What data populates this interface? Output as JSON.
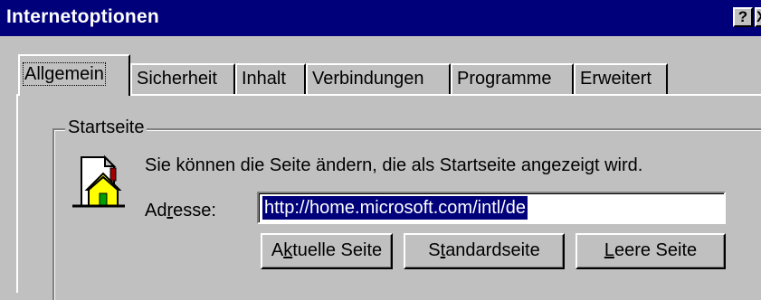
{
  "window": {
    "title": "Internetoptionen",
    "help_label": "?",
    "close_label": "X"
  },
  "tabs": [
    {
      "label": "Allgemein",
      "active": true
    },
    {
      "label": "Sicherheit"
    },
    {
      "label": "Inhalt"
    },
    {
      "label": "Verbindungen"
    },
    {
      "label": "Programme"
    },
    {
      "label": "Erweitert"
    }
  ],
  "startseite": {
    "group_title": "Startseite",
    "description": "Sie können die Seite ändern, die als Startseite angezeigt wird.",
    "address_label": {
      "pre": "Ad",
      "accel": "r",
      "post": "esse:"
    },
    "address_value": "http://home.microsoft.com/intl/de",
    "buttons": {
      "current": {
        "pre": "A",
        "accel": "k",
        "post": "tuelle Seite"
      },
      "standard": {
        "pre": "S",
        "accel": "t",
        "post": "andardseite"
      },
      "blank": {
        "pre": "",
        "accel": "L",
        "post": "eere Seite"
      }
    }
  },
  "icons": {
    "home": "home-page-icon"
  }
}
